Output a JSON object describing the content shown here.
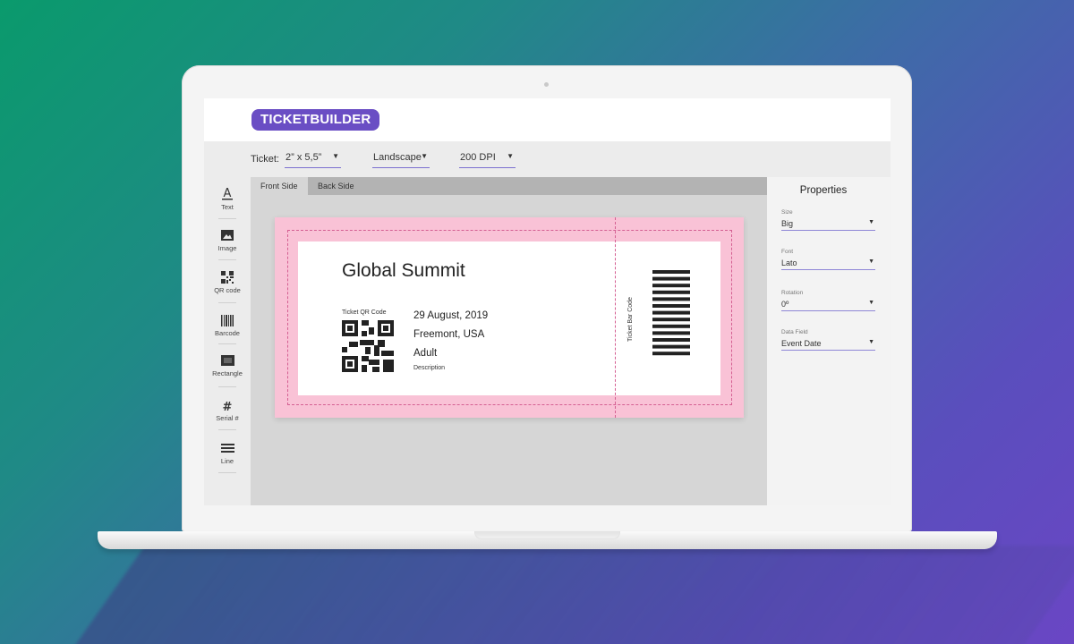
{
  "app": {
    "logo": "TICKETBUILDER"
  },
  "toolbar": {
    "ticket_label": "Ticket:",
    "size_value": "2” x 5,5”",
    "orientation_value": "Landscape",
    "dpi_value": "200 DPI"
  },
  "tools": [
    {
      "label": "Text",
      "icon": "text-icon"
    },
    {
      "label": "Image",
      "icon": "image-icon"
    },
    {
      "label": "QR code",
      "icon": "qr-code-icon"
    },
    {
      "label": "Barcode",
      "icon": "barcode-icon"
    },
    {
      "label": "Rectangle",
      "icon": "rectangle-icon"
    },
    {
      "label": "Serial #",
      "icon": "hash-icon"
    },
    {
      "label": "Line",
      "icon": "line-icon"
    }
  ],
  "tabs": {
    "front": "Front Side",
    "back": "Back Side"
  },
  "ticket": {
    "title": "Global Summit",
    "qr_label": "Ticket QR Code",
    "date": "29 August, 2019",
    "location": "Freemont, USA",
    "type": "Adult",
    "description": "Description",
    "barcode_label": "Ticket Bar Code"
  },
  "properties": {
    "title": "Properties",
    "size": {
      "caption": "Size",
      "value": "Big"
    },
    "font": {
      "caption": "Font",
      "value": "Lato"
    },
    "rotation": {
      "caption": "Rotation",
      "value": "0º"
    },
    "data_field": {
      "caption": "Data Field",
      "value": "Event Date"
    }
  },
  "colors": {
    "accent": "#6a4ec4",
    "ticket_background": "#f9c2d6",
    "guide_line": "#d45f92",
    "select_underline": "#8e86d6"
  }
}
